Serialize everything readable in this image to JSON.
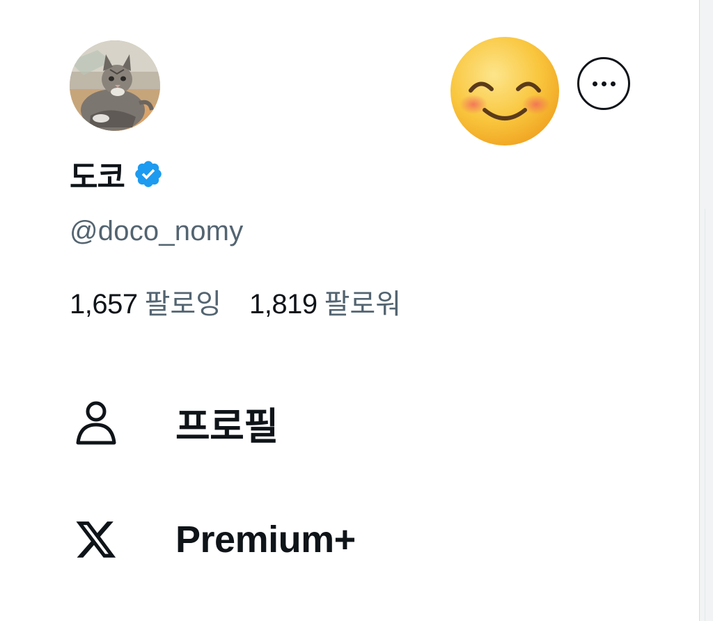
{
  "profile": {
    "display_name": "도코",
    "handle": "@doco_nomy",
    "verified": true,
    "avatar_icon": "cat-photo-avatar"
  },
  "stats": {
    "following_count": "1,657",
    "following_label": "팔로잉",
    "followers_count": "1,819",
    "followers_label": "팔로워"
  },
  "header": {
    "emoji_icon": "smiling-face-with-smiling-eyes-emoji",
    "more_icon": "more-options-icon"
  },
  "menu": {
    "items": [
      {
        "label": "프로필",
        "icon": "person-icon"
      },
      {
        "label": "Premium+",
        "icon": "x-logo-icon"
      }
    ]
  },
  "colors": {
    "text_primary": "#0f1419",
    "text_secondary": "#536471",
    "verified_blue": "#1d9bf0",
    "background": "#ffffff"
  }
}
